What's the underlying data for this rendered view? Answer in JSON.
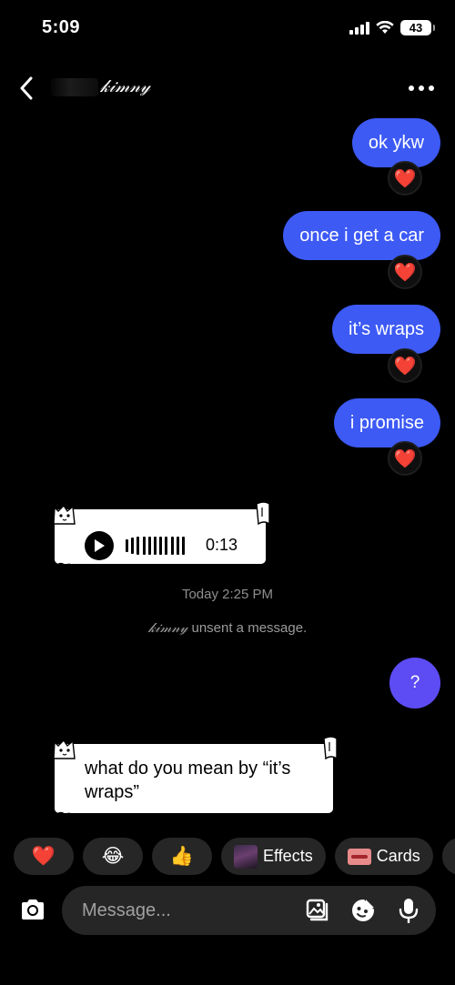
{
  "status_bar": {
    "time": "5:09",
    "battery": "43"
  },
  "header": {
    "contact_name": "𝓀𝒾𝓂𝓃𝓎"
  },
  "messages": {
    "sent_1": "ok ykw",
    "sent_2": "once i get a car",
    "sent_3": "it’s wraps",
    "sent_4": "i promise",
    "reaction": "❤️",
    "voice_duration": "0:13",
    "timestamp": "Today 2:25 PM",
    "unsent_name": "𝓀𝒾𝓂𝓃𝓎",
    "unsent_text": " unsent a message.",
    "sent_question": "?",
    "received_text": "what do you mean by “it’s wraps”"
  },
  "quick_reactions": {
    "heart": "❤️",
    "laugh": "😂",
    "thumbs": "👍",
    "effects_label": "Effects",
    "cards_label": "Cards"
  },
  "composer": {
    "placeholder": "Message..."
  },
  "colors": {
    "sent_bubble": "#3d5af5",
    "question_bubble": "#5d4cf4",
    "chip_bg": "#262626"
  },
  "icons": [
    "back-icon",
    "more-icon",
    "play-icon",
    "camera-icon",
    "gallery-icon",
    "sticker-icon",
    "microphone-icon"
  ]
}
